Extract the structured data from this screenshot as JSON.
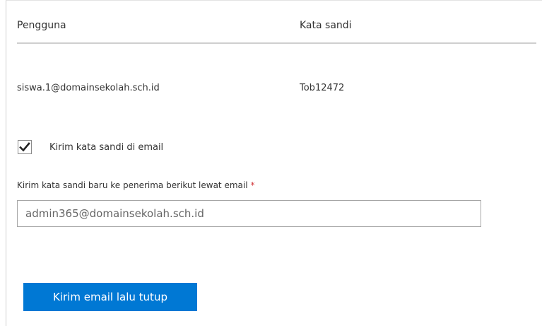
{
  "table": {
    "headers": {
      "user": "Pengguna",
      "password": "Kata sandi"
    },
    "rows": [
      {
        "user": "siswa.1@domainsekolah.sch.id",
        "password": "Tob12472"
      }
    ]
  },
  "send_password": {
    "checked": true,
    "label": "Kirim kata sandi di email",
    "icon": "checkmark-icon"
  },
  "recipient": {
    "label": "Kirim kata sandi baru ke penerima berikut lewat email",
    "required_marker": "*",
    "value": "admin365@domainsekolah.sch.id"
  },
  "submit": {
    "label": "Kirim email lalu tutup"
  },
  "colors": {
    "accent": "#0078d4",
    "required": "#d13438",
    "divider": "#cfcfcf"
  }
}
